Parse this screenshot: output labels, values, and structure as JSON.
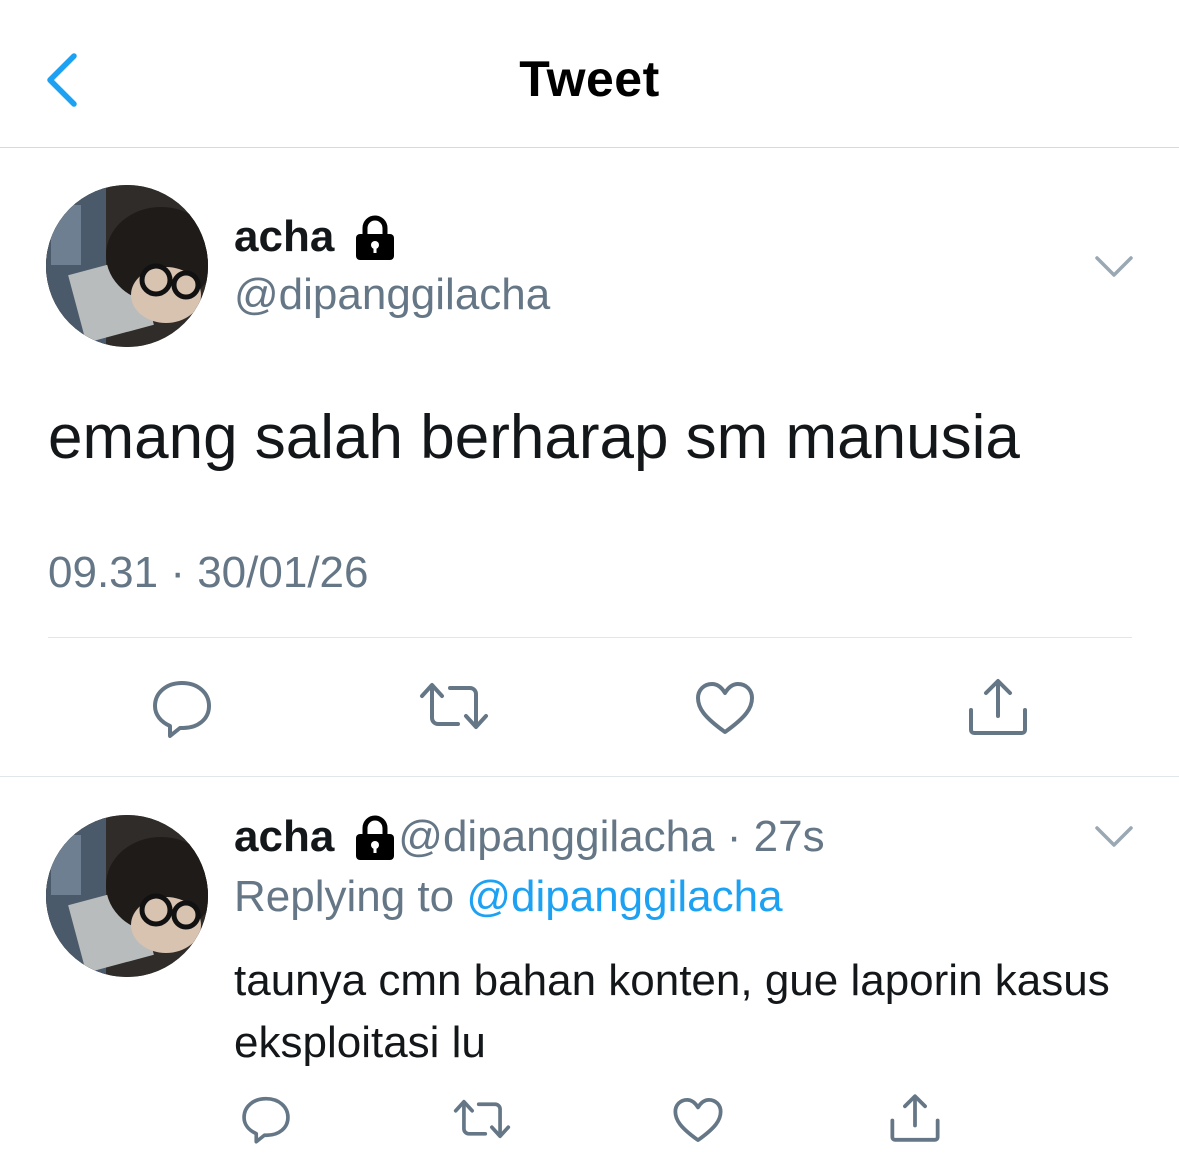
{
  "header": {
    "title": "Tweet",
    "back_icon": "chevron-left-icon"
  },
  "colors": {
    "accent": "#1da1f2",
    "secondary_text": "#657786",
    "primary_text": "#14171a",
    "icon_gray": "#657786"
  },
  "main_tweet": {
    "display_name": "acha",
    "handle": "@dipanggilacha",
    "text": "emang salah berharap sm manusia",
    "timestamp": "09.31 · 30/01/26",
    "actions": [
      "reply-icon",
      "retweet-icon",
      "like-icon",
      "share-icon"
    ]
  },
  "reply_tweet": {
    "display_name": "acha",
    "handle": "@dipanggilacha",
    "separator": " · ",
    "time_ago": "27s",
    "replying_prefix": "Replying to ",
    "replying_to": "@dipanggilacha",
    "text": "taunya cmn bahan konten, gue laporin kasus eksploitasi lu",
    "actions": [
      "reply-icon",
      "retweet-icon",
      "like-icon",
      "share-icon"
    ]
  }
}
